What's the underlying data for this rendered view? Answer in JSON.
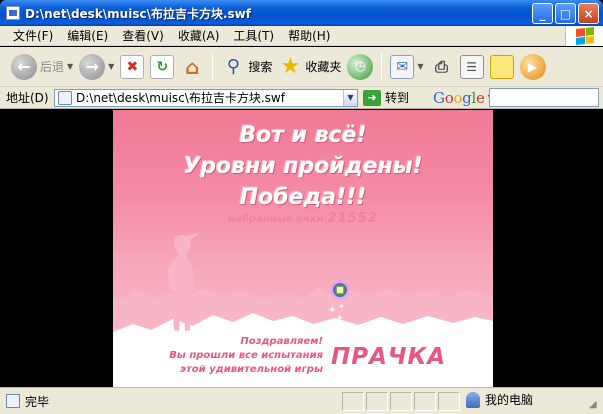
{
  "window": {
    "title": "D:\\net\\desk\\muisc\\布拉吉卡方块.swf",
    "buttons": {
      "minimize": "_",
      "maximize": "□",
      "close": "×"
    }
  },
  "menu": [
    "文件(F)",
    "编辑(E)",
    "查看(V)",
    "收藏(A)",
    "工具(T)",
    "帮助(H)"
  ],
  "toolbar": {
    "back_label": "后退",
    "search_label": "搜索",
    "favorites_label": "收藏夹"
  },
  "address": {
    "label": "地址(D)",
    "value": "D:\\net\\desk\\muisc\\布拉吉卡方块.swf",
    "go_label": "转到",
    "google_letters": [
      "G",
      "o",
      "o",
      "g",
      "l",
      "e"
    ],
    "search_value": ""
  },
  "game": {
    "line1": "Вот и всё!",
    "line2": "Уровни пройдены!",
    "line3": "Победа!!!",
    "score_label": "набранные очки:",
    "score_value": "21552",
    "congrats1": "Поздравляем!",
    "congrats2": "Вы прошли все испытания",
    "congrats3": "этой удивительной игры",
    "brand": "ПРАЧКА",
    "colors": {
      "sky_top": "#f07a96",
      "snow": "#ffffff",
      "text_pink": "#e8587e"
    }
  },
  "status": {
    "text": "完毕",
    "zone": "我的电脑"
  }
}
